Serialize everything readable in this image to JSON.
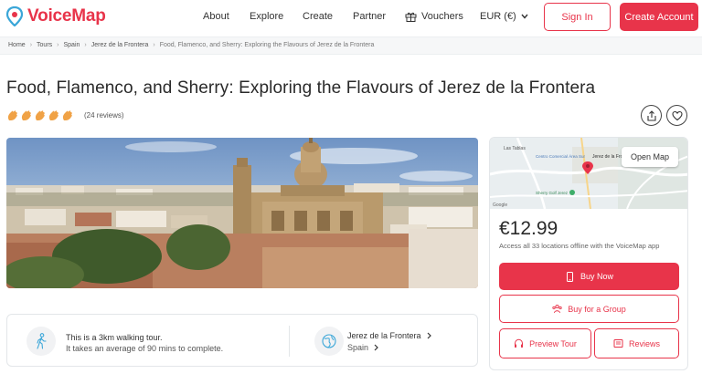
{
  "brand": {
    "name": "VoiceMap",
    "accent": "#e8344a"
  },
  "nav": {
    "about": "About",
    "explore": "Explore",
    "create": "Create",
    "partner": "Partner",
    "vouchers": "Vouchers",
    "currency": "EUR (€)",
    "sign_in": "Sign In",
    "create_account": "Create Account"
  },
  "breadcrumb": {
    "items": [
      "Home",
      "Tours",
      "Spain",
      "Jerez de la Frontera"
    ],
    "current": "Food, Flamenco, and Sherry: Exploring the Flavours of Jerez de la Frontera"
  },
  "tour": {
    "title": "Food, Flamenco, and Sherry: Exploring the Flavours of Jerez de la Frontera",
    "reviews": "(24 reviews)",
    "rating_icons": 5
  },
  "info": {
    "walk_line1": "This is a 3km walking tour.",
    "walk_line2": "It takes an average of 90 mins to complete.",
    "city": "Jerez de la Frontera",
    "country": "Spain"
  },
  "map": {
    "open_map": "Open Map",
    "labels": {
      "las_tablas": "Las Tablas",
      "centro": "Centro Comercial Área Sur",
      "jerez": "Jerez de la Frontera",
      "sherry": "Sherry Golf Jerez",
      "google": "Google"
    }
  },
  "purchase": {
    "price": "€12.99",
    "note": "Access all 33 locations offline with the VoiceMap app",
    "buy_now": "Buy Now",
    "buy_group": "Buy for a Group",
    "preview": "Preview Tour",
    "reviews": "Reviews"
  }
}
